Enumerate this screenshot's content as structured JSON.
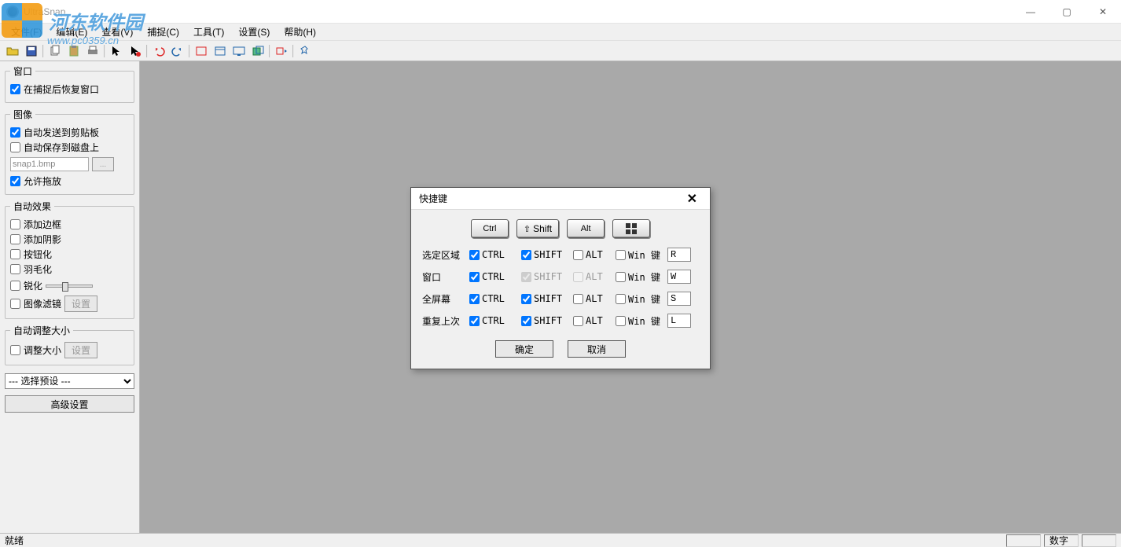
{
  "app": {
    "title": "UltraSnap"
  },
  "watermark": {
    "text": "河东软件园",
    "sub": "www.pc0359.cn"
  },
  "menu": {
    "file": "文件(F)",
    "edit": "编辑(E)",
    "view": "查看(V)",
    "capture": "捕捉(C)",
    "tools": "工具(T)",
    "settings": "设置(S)",
    "help": "帮助(H)"
  },
  "sidebar": {
    "window_group": "窗口",
    "restore_after_capture": "在捕捉后恢复窗口",
    "image_group": "图像",
    "auto_clipboard": "自动发送到剪贴板",
    "auto_save_disk": "自动保存到磁盘上",
    "filename": "snap1.bmp",
    "allow_drag": "允许拖放",
    "auto_effects_group": "自动效果",
    "add_border": "添加边框",
    "add_shadow": "添加阴影",
    "buttonize": "按钮化",
    "feather": "羽毛化",
    "sharpen": "锐化",
    "image_filter": "图像滤镜",
    "filter_settings": "设置",
    "auto_resize_group": "自动调整大小",
    "resize": "调整大小",
    "resize_settings": "设置",
    "preset_placeholder": "--- 选择预设 ---",
    "advanced": "高级设置"
  },
  "dialog": {
    "title": "快捷键",
    "keycaps": {
      "ctrl": "Ctrl",
      "shift": "Shift",
      "alt": "Alt",
      "win": "⊞"
    },
    "cols": {
      "ctrl": "CTRL",
      "shift": "SHIFT",
      "alt": "ALT",
      "win": "Win 键"
    },
    "rows": [
      {
        "label": "选定区域",
        "ctrl": true,
        "shift": true,
        "alt": false,
        "win": false,
        "key": "R",
        "shift_disabled": false,
        "alt_disabled": false
      },
      {
        "label": "窗口",
        "ctrl": true,
        "shift": true,
        "alt": false,
        "win": false,
        "key": "W",
        "shift_disabled": true,
        "alt_disabled": true
      },
      {
        "label": "全屏幕",
        "ctrl": true,
        "shift": true,
        "alt": false,
        "win": false,
        "key": "S",
        "shift_disabled": false,
        "alt_disabled": false
      },
      {
        "label": "重复上次",
        "ctrl": true,
        "shift": true,
        "alt": false,
        "win": false,
        "key": "L",
        "shift_disabled": false,
        "alt_disabled": false
      }
    ],
    "ok": "确定",
    "cancel": "取消"
  },
  "status": {
    "ready": "就绪",
    "num": "数字"
  }
}
